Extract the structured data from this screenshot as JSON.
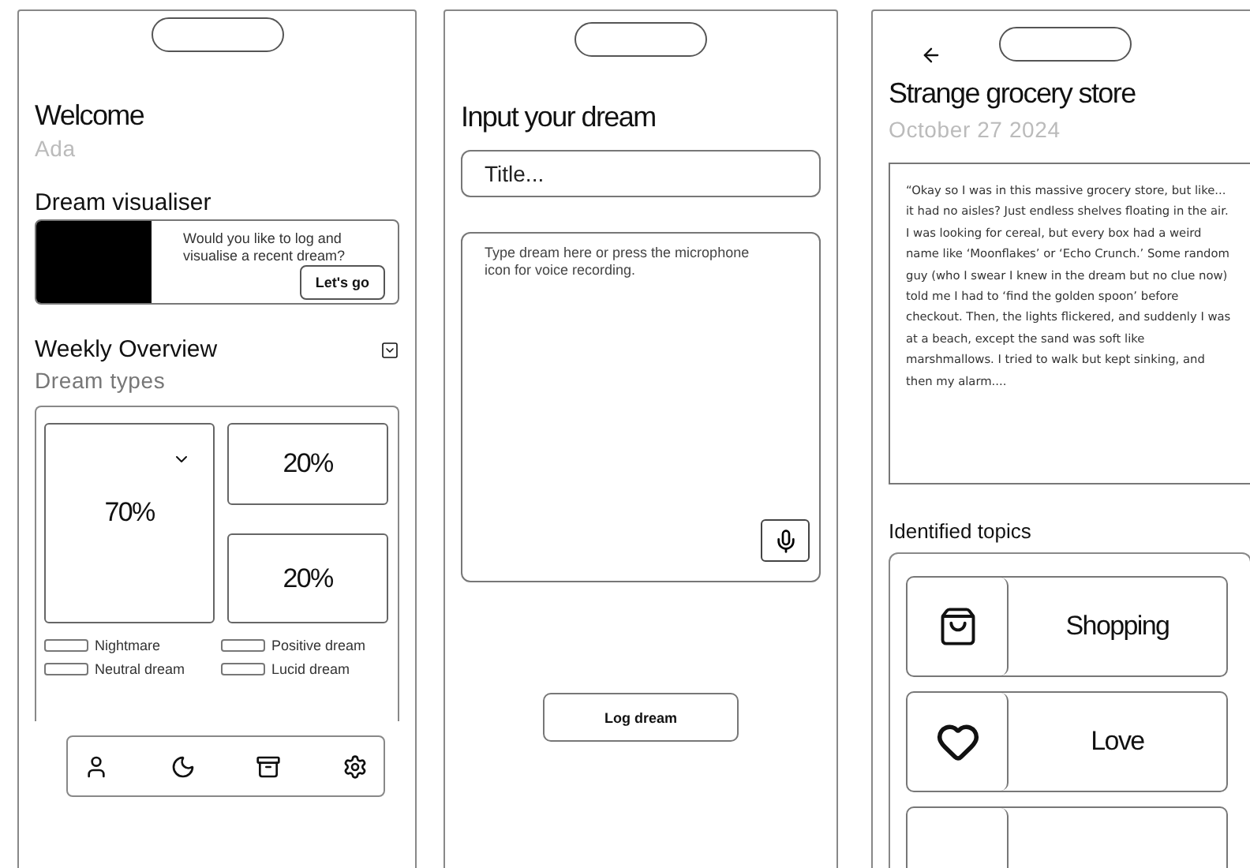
{
  "home": {
    "title": "Welcome",
    "user": "Ada",
    "visualiser": {
      "heading": "Dream visualiser",
      "prompt": "Would you like to log and visualise a recent dream?",
      "button": "Let's go"
    },
    "overview": {
      "heading": "Weekly Overview",
      "subheading": "Dream types",
      "tiles": [
        {
          "value": "70%",
          "kind": "large"
        },
        {
          "value": "20%",
          "kind": "small"
        },
        {
          "value": "20%",
          "kind": "small"
        }
      ],
      "legend": [
        "Nightmare",
        "Positive dream",
        "Neutral dream",
        "Lucid dream"
      ]
    }
  },
  "input": {
    "title": "Input your dream",
    "title_field": {
      "placeholder": "Title..."
    },
    "body_field": {
      "placeholder": "Type dream here or press the microphone icon for voice recording."
    },
    "button": "Log dream"
  },
  "detail": {
    "title": "Strange grocery store",
    "date": "October 27 2024",
    "text": "“Okay so I was in this massive grocery store, but like... it had no aisles? Just endless shelves floating in the air.\nI was looking for cereal, but every box had a weird name like ‘Moonflakes’ or ‘Echo Crunch.’ Some random guy (who I swear I knew in the dream but no clue now) told me I had to ‘find the golden spoon’ before checkout. Then, the lights flickered, and suddenly I was at a beach, except the sand was soft like marshmallows. I tried to walk but kept sinking, and then my alarm....",
    "topics_heading": "Identified topics",
    "topics": [
      {
        "label": "Shopping",
        "kind": "shopping"
      },
      {
        "label": "Love",
        "kind": "love"
      }
    ]
  }
}
